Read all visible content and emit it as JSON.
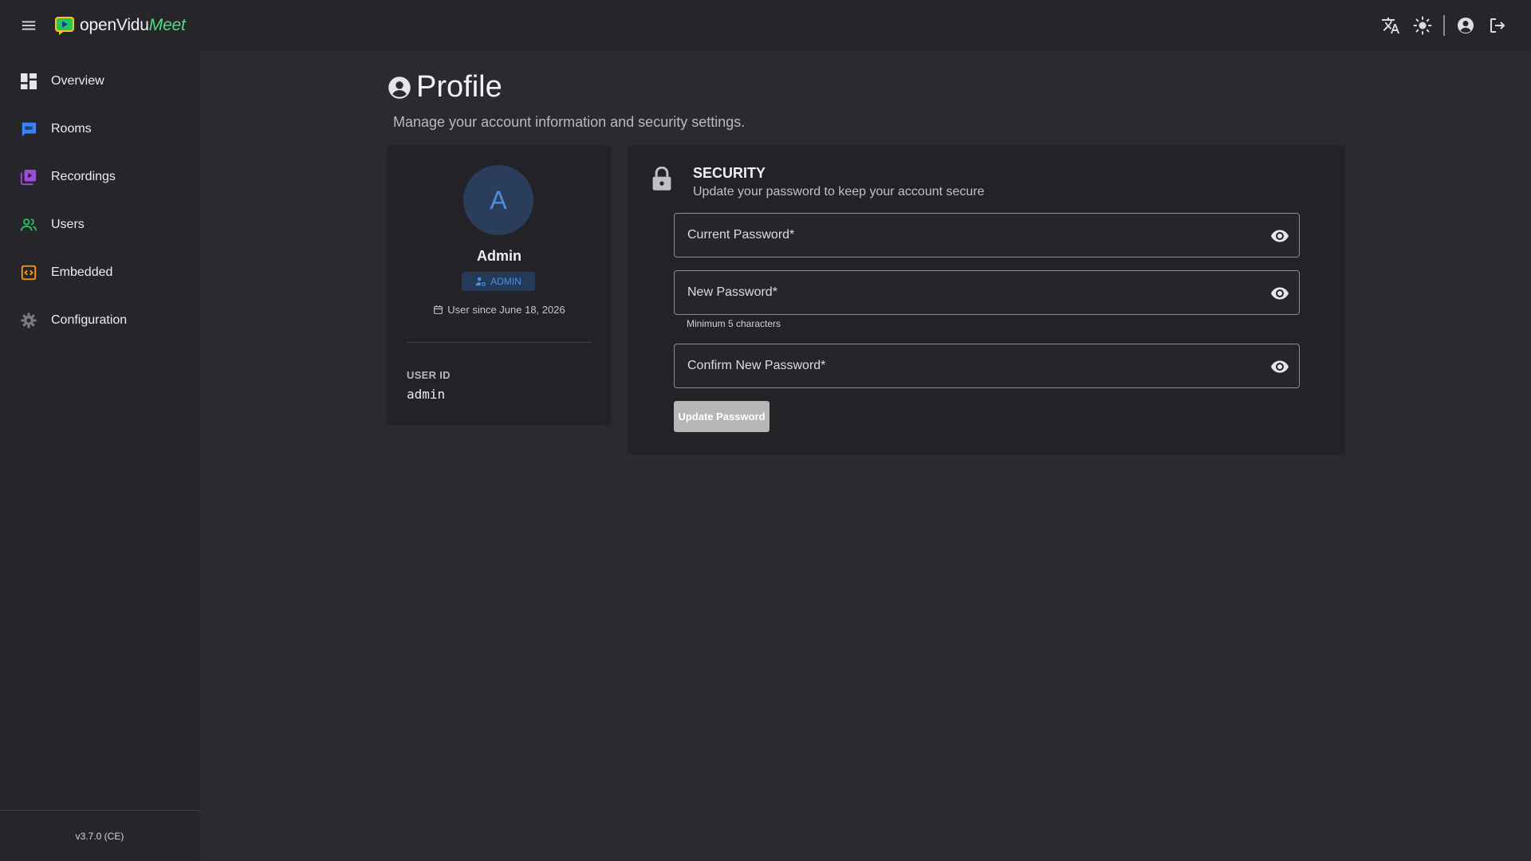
{
  "app": {
    "logo_open": "openVidu",
    "logo_meet": "Meet"
  },
  "colors": {
    "background": "#2a2a30",
    "sidebar": "#25252a",
    "card": "#222227",
    "accent_blue": "#4f8be0",
    "logo_green": "#4ade80"
  },
  "topbar": {
    "icons": [
      "menu-icon",
      "translate-icon",
      "theme-light-icon",
      "account-circle-icon",
      "logout-icon"
    ]
  },
  "sidebar": {
    "items": [
      {
        "label": "Overview",
        "icon": "dashboard-icon",
        "color": "#e6e6ea"
      },
      {
        "label": "Rooms",
        "icon": "rooms-icon",
        "color": "#3b82f6"
      },
      {
        "label": "Recordings",
        "icon": "recordings-icon",
        "color": "#9b4fd6"
      },
      {
        "label": "Users",
        "icon": "users-icon",
        "color": "#22c55e"
      },
      {
        "label": "Embedded",
        "icon": "embedded-icon",
        "color": "#f59e0b"
      },
      {
        "label": "Configuration",
        "icon": "gear-icon",
        "color": "#7a7a82"
      }
    ],
    "version": "v3.7.0 (CE)"
  },
  "page": {
    "title": "Profile",
    "subtitle": "Manage your account information and security settings."
  },
  "profile": {
    "avatar_letter": "A",
    "name": "Admin",
    "role": "ADMIN",
    "since": "User since June 18, 2026",
    "user_id_label": "USER ID",
    "user_id": "admin"
  },
  "security": {
    "title": "SECURITY",
    "subtitle": "Update your password to keep your account secure",
    "current_password_placeholder": "Current Password*",
    "new_password_placeholder": "New Password*",
    "new_password_hint": "Minimum 5 characters",
    "confirm_password_placeholder": "Confirm New Password*",
    "update_button": "Update Password"
  }
}
